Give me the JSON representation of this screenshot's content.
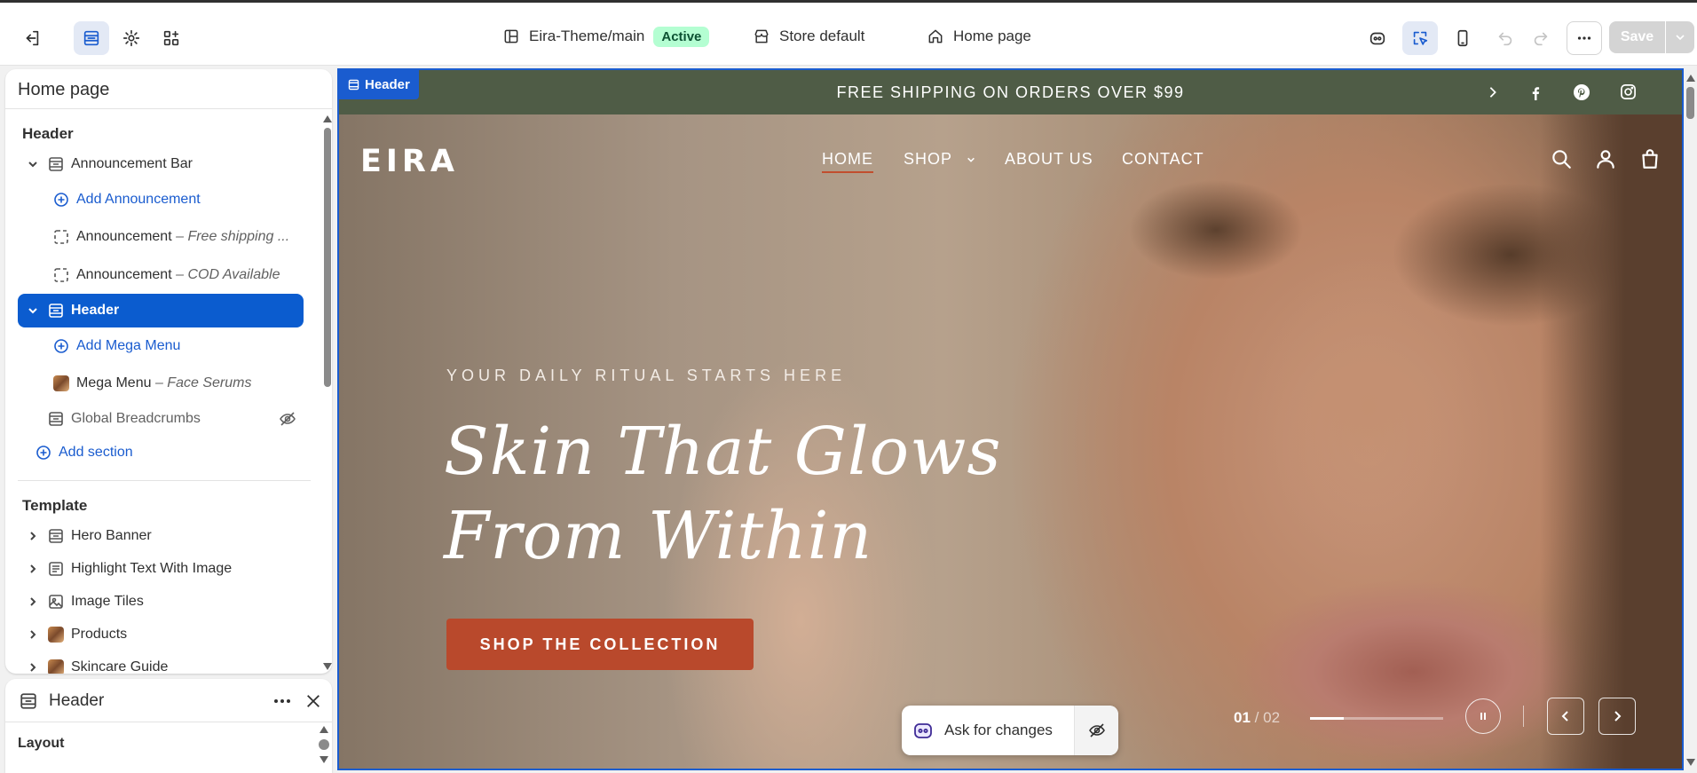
{
  "topbar": {
    "theme_name": "Eira-Theme/main",
    "theme_status": "Active",
    "store_context": "Store default",
    "page_selector": "Home page",
    "save_label": "Save"
  },
  "sidebar": {
    "title": "Home page",
    "header_group_label": "Header",
    "template_group_label": "Template",
    "rows": {
      "announcement_bar": "Announcement Bar",
      "add_announcement": "Add Announcement",
      "announcement_1_name": "Announcement",
      "announcement_1_detail": "– Free shipping ...",
      "announcement_2_name": "Announcement",
      "announcement_2_detail": "– COD Available",
      "header": "Header",
      "add_mega_menu": "Add Mega Menu",
      "mega_menu_name": "Mega Menu",
      "mega_menu_detail": "– Face Serums",
      "global_breadcrumbs": "Global Breadcrumbs",
      "add_section": "Add section",
      "hero_banner": "Hero Banner",
      "highlight_text": "Highlight Text With Image",
      "image_tiles": "Image Tiles",
      "products": "Products",
      "skincare_guide": "Skincare Guide"
    }
  },
  "settings_panel": {
    "title": "Header",
    "section_label": "Layout"
  },
  "preview": {
    "selection_tag": "Header",
    "announcement_text": "FREE SHIPPING ON ORDERS OVER $99",
    "logo": "EIRA",
    "nav": {
      "home": "HOME",
      "shop": "SHOP",
      "about": "ABOUT US",
      "contact": "CONTACT"
    },
    "hero": {
      "kicker": "YOUR DAILY RITUAL STARTS HERE",
      "headline_line1": "Skin That Glows",
      "headline_line2": "From Within",
      "cta": "SHOP THE COLLECTION",
      "slide_current": "01",
      "slide_separator": "/",
      "slide_total": "02",
      "slide_progress": 0.25
    },
    "ask_label": "Ask for changes"
  },
  "colors": {
    "accent": "#1a5ccf",
    "announcement_bg": "#4f5c46",
    "cta_bg": "#b9492c",
    "active_badge_bg": "#b4fed2"
  },
  "icons": [
    "exit-icon",
    "sections-icon",
    "settings-icon",
    "apps-icon",
    "theme-icon",
    "store-icon",
    "home-icon",
    "ai-assistant-icon",
    "inspector-icon",
    "mobile-icon",
    "undo-icon",
    "redo-icon",
    "more-icon",
    "chevron-down-icon",
    "facebook-icon",
    "pinterest-icon",
    "instagram-icon",
    "search-icon",
    "account-icon",
    "cart-icon",
    "pause-icon",
    "close-icon",
    "eye-off-icon"
  ]
}
